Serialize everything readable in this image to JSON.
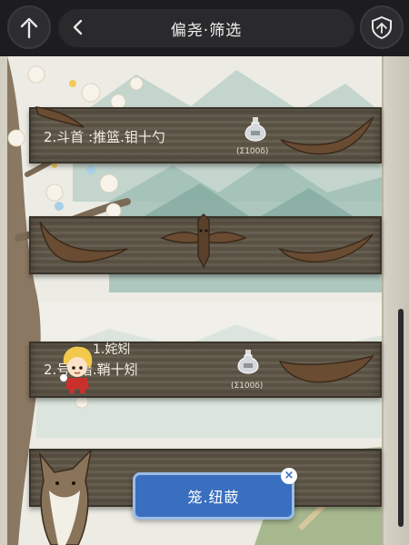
{
  "header": {
    "title": "偏尧·筛选",
    "left_icon": "tree-up-arrow-icon",
    "back_icon": "chevron-left-icon",
    "right_icon": "shield-icon"
  },
  "rows": [
    {
      "label": "2.斗首 :推篮.钼十勺",
      "potion_value": "(Σ100δ)"
    },
    {
      "label": "",
      "potion_value": ""
    },
    {
      "label": "2.号  .揞.鞘十矧",
      "potion_value": "(Σ100δ)",
      "overlay_text": "1.姹矧"
    },
    {
      "label": "",
      "potion_value": ""
    }
  ],
  "action_button": {
    "label": "笼.纽菣",
    "close": "×"
  },
  "colors": {
    "topbar": "#1d1d1f",
    "plank": "#5e5647",
    "button": "#3a6fbf"
  }
}
